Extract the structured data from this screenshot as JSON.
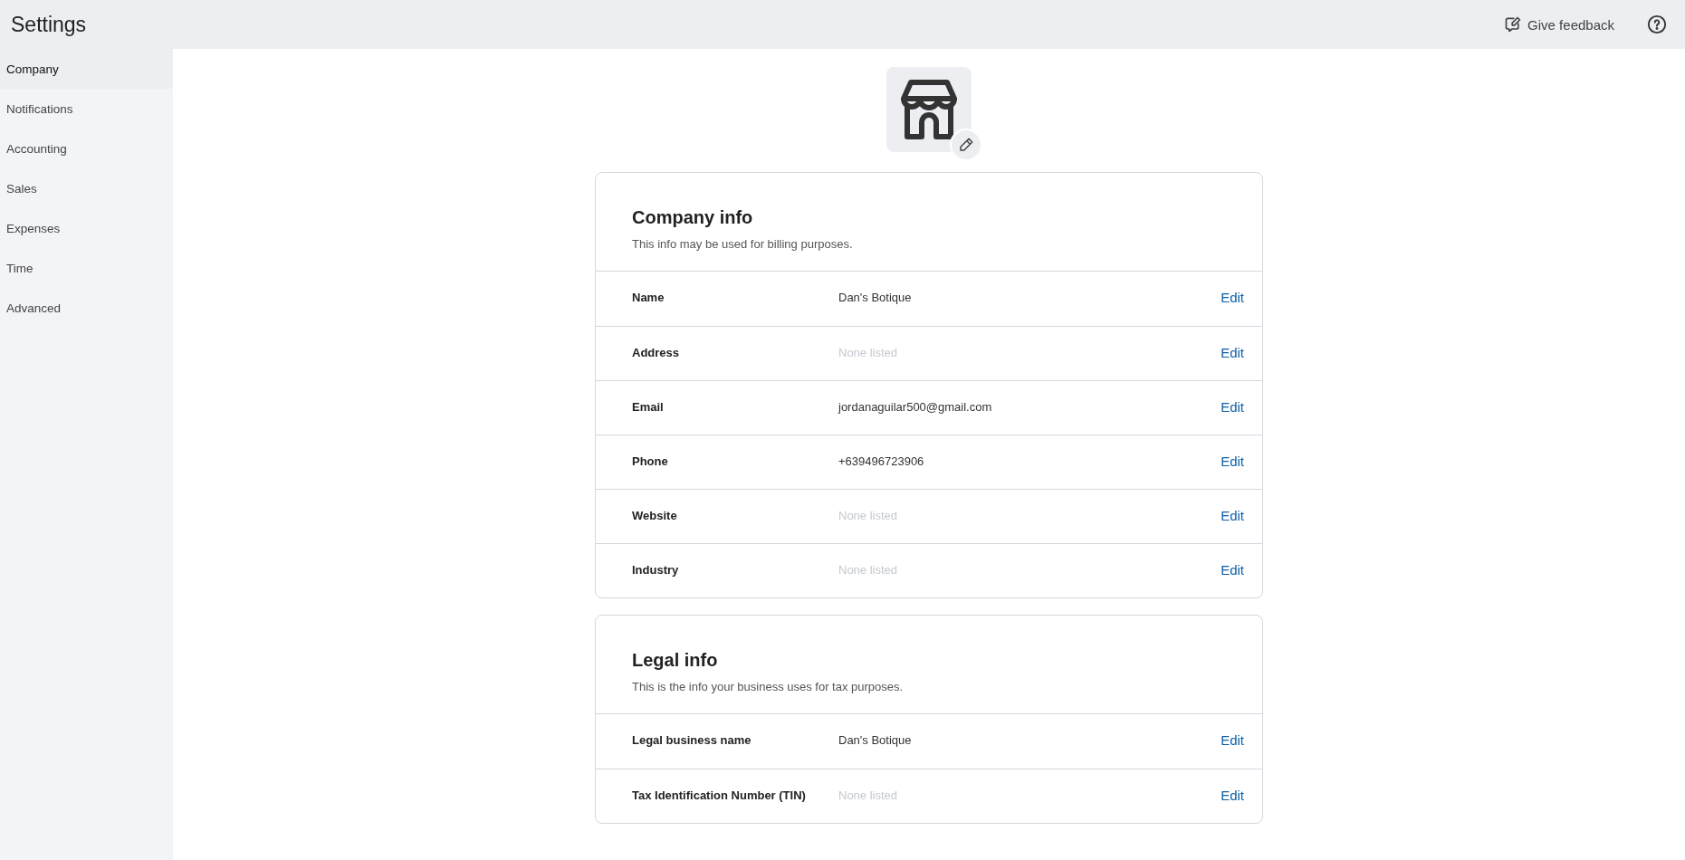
{
  "header": {
    "title": "Settings",
    "feedback": "Give feedback"
  },
  "sidebar": {
    "items": [
      {
        "label": "Company",
        "selected": true
      },
      {
        "label": "Notifications",
        "selected": false
      },
      {
        "label": "Accounting",
        "selected": false
      },
      {
        "label": "Sales",
        "selected": false
      },
      {
        "label": "Expenses",
        "selected": false
      },
      {
        "label": "Time",
        "selected": false
      },
      {
        "label": "Advanced",
        "selected": false
      }
    ]
  },
  "sections": [
    {
      "title": "Company info",
      "subtitle": "This info may be used for billing purposes.",
      "rows": [
        {
          "label": "Name",
          "value": "Dan's Botique",
          "empty": false,
          "action": "Edit"
        },
        {
          "label": "Address",
          "value": "None listed",
          "empty": true,
          "action": "Edit"
        },
        {
          "label": "Email",
          "value": "jordanaguilar500@gmail.com",
          "empty": false,
          "action": "Edit"
        },
        {
          "label": "Phone",
          "value": "+639496723906",
          "empty": false,
          "action": "Edit"
        },
        {
          "label": "Website",
          "value": "None listed",
          "empty": true,
          "action": "Edit"
        },
        {
          "label": "Industry",
          "value": "None listed",
          "empty": true,
          "action": "Edit"
        }
      ]
    },
    {
      "title": "Legal info",
      "subtitle": "This is the info your business uses for tax purposes.",
      "rows": [
        {
          "label": "Legal business name",
          "value": "Dan's Botique",
          "empty": false,
          "action": "Edit"
        },
        {
          "label": "Tax Identification Number (TIN)",
          "value": "None listed",
          "empty": true,
          "action": "Edit"
        }
      ]
    }
  ]
}
